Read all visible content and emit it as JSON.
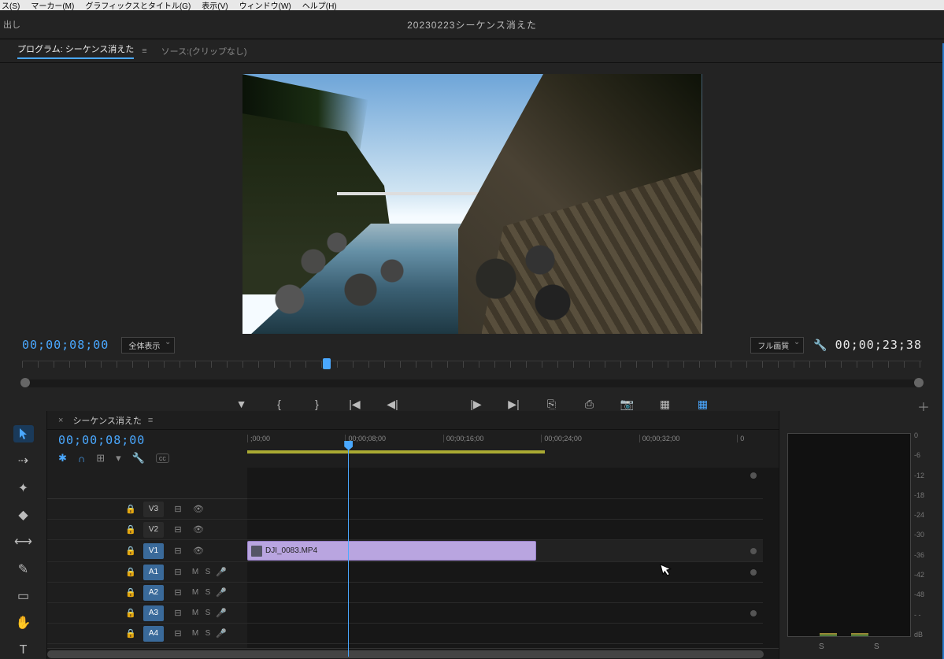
{
  "menu": {
    "items": [
      "ス(S)",
      "マーカー(M)",
      "グラフィックスとタイトル(G)",
      "表示(V)",
      "ウィンドウ(W)",
      "ヘルプ(H)"
    ]
  },
  "topbar": {
    "left": "出し",
    "title": "20230223シーケンス消えた"
  },
  "programPanel": {
    "tabActive": "プログラム: シーケンス消えた",
    "tabMenu": "≡",
    "tabSource": "ソース:(クリップなし)",
    "timecode": "00;00;08;00",
    "zoom": "全体表示",
    "quality": "フル画質",
    "duration": "00;00;23;38"
  },
  "transport": {
    "marker": "▼",
    "inpoint": "{",
    "outpoint": "}",
    "gotoIn": "|◀",
    "stepBack": "◀|",
    "stepFwd": "|▶",
    "gotoOut": "▶|",
    "lift": "⎘",
    "extract": "⎙",
    "snapshot": "📷",
    "comp1": "▦",
    "comp2": "▦",
    "add": "＋"
  },
  "tools": [
    "▲",
    "⇢",
    "✂",
    "⇔",
    "⟷",
    "✎",
    "▭",
    "✋",
    "T"
  ],
  "timeline": {
    "seqName": "シーケンス消えた",
    "close": "×",
    "menu": "≡",
    "timecode": "00;00;08;00",
    "ruler": [
      ";00;00",
      "00;00;08;00",
      "00;00;16;00",
      "00;00;24;00",
      "00;00;32;00",
      "0"
    ],
    "tracks": {
      "v3": "V3",
      "v2": "V2",
      "v1": "V1",
      "a1": "A1",
      "a2": "A2",
      "a3": "A3",
      "a4": "A4"
    },
    "clipName": "DJI_0083.MP4",
    "cc": "cc"
  },
  "audio": {
    "s1": "S",
    "s2": "S",
    "db": [
      "0",
      "-6",
      "-12",
      "-18",
      "-24",
      "-30",
      "-36",
      "-42",
      "-48",
      "- -",
      "dB"
    ]
  }
}
